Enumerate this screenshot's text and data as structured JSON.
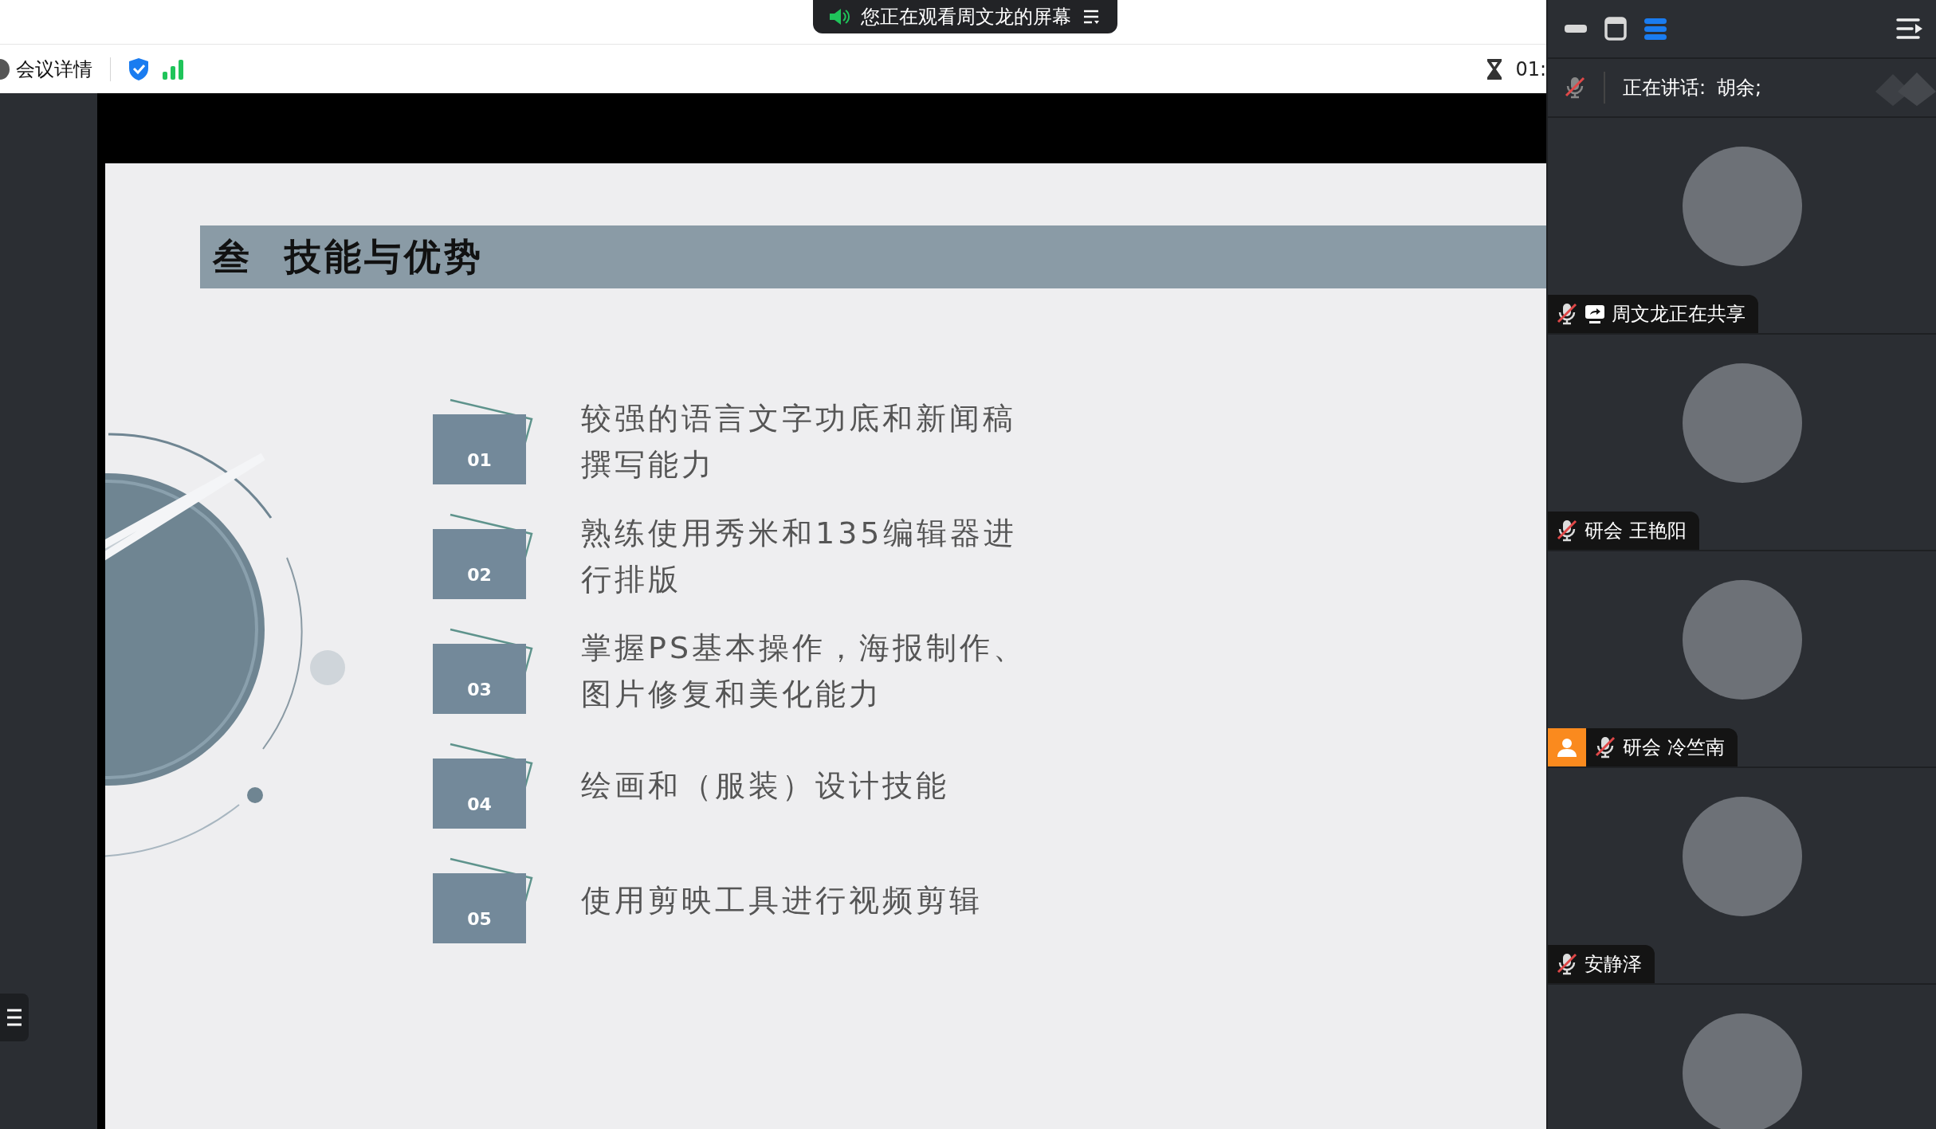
{
  "banner": {
    "text": "您正在观看周文龙的屏幕"
  },
  "toolbar": {
    "meeting_info": "会议详情",
    "timer": "01:"
  },
  "slide": {
    "number": "叁",
    "title": "技能与优势",
    "items": [
      {
        "number": "01",
        "lines": [
          "较强的语言文字功底和新闻稿",
          "撰写能力"
        ]
      },
      {
        "number": "02",
        "lines": [
          "熟练使用秀米和135编辑器进",
          "行排版"
        ]
      },
      {
        "number": "03",
        "lines": [
          "掌握PS基本操作，海报制作、",
          "图片修复和美化能力"
        ]
      },
      {
        "number": "04",
        "lines": [
          "绘画和（服装）设计技能"
        ]
      },
      {
        "number": "05",
        "lines": [
          "使用剪映工具进行视频剪辑"
        ]
      }
    ]
  },
  "panel": {
    "view_buttons": [
      {
        "kind": "minimize",
        "selected": false
      },
      {
        "kind": "window",
        "selected": false
      },
      {
        "kind": "list",
        "selected": true
      }
    ],
    "speaking": {
      "label": "正在讲话:",
      "names": "胡余;"
    },
    "participants": [
      {
        "avatar": true,
        "name": "周文龙正在共享",
        "muted": true,
        "sharing": true,
        "host": false
      },
      {
        "avatar": true,
        "name": "研会 王艳阳",
        "muted": true,
        "sharing": false,
        "host": false
      },
      {
        "avatar": true,
        "name": "研会 冷竺南",
        "muted": true,
        "sharing": false,
        "host": true
      },
      {
        "avatar": true,
        "name": "安静泽",
        "muted": true,
        "sharing": false,
        "host": false
      },
      {
        "avatar": true
      }
    ]
  }
}
